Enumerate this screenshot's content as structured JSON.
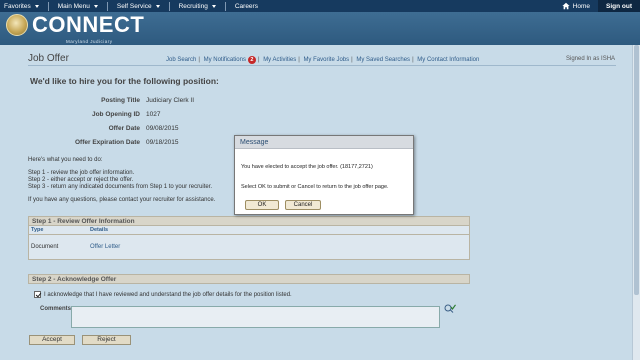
{
  "topnav": {
    "favorites": "Favorites",
    "main_menu": "Main Menu",
    "self_service": "Self Service",
    "recruiting": "Recruiting",
    "careers": "Careers",
    "home": "Home",
    "sign_out": "Sign out"
  },
  "branding": {
    "logo_text": "CONNECT",
    "logo_sub": "Maryland Judiciary"
  },
  "page": {
    "title": "Job Offer",
    "signed_in": "Signed In as ISHA",
    "links": {
      "job_search": "Job Search",
      "my_notifications": "My Notifications",
      "notifications_count": "2",
      "my_activities": "My Activities",
      "my_favorite_jobs": "My Favorite Jobs",
      "my_saved_searches": "My Saved Searches",
      "my_contact_information": "My Contact Information"
    },
    "heading": "We'd like to hire you for the following position:",
    "fields": {
      "posting_title_label": "Posting Title",
      "posting_title": "Judiciary Clerk II",
      "job_opening_id_label": "Job Opening ID",
      "job_opening_id": "1027",
      "offer_date_label": "Offer Date",
      "offer_date": "09/08/2015",
      "offer_expiration_label": "Offer Expiration Date",
      "offer_expiration": "09/18/2015"
    },
    "instructions": {
      "intro": "Here's what you need to do:",
      "step1": "Step 1 - review the job offer information.",
      "step2": "Step 2 - either accept or reject the offer.",
      "step3": "Step 3 - return any indicated documents from Step 1 to your recruiter.",
      "contact": "If you have any questions, please contact your recruiter for assistance."
    },
    "step1": {
      "header": "Step 1 - Review Offer Information",
      "col_type": "Type",
      "col_details": "Details",
      "row_type": "Document",
      "row_details": "Offer Letter"
    },
    "step2": {
      "header": "Step 2 - Acknowledge Offer",
      "ack_text": "I acknowledge that I have reviewed and understand the job offer details for the position listed.",
      "comments_label": "Comments"
    },
    "buttons": {
      "accept": "Accept",
      "reject": "Reject"
    }
  },
  "modal": {
    "title": "Message",
    "line1": "You have elected to accept the job offer. (18177,2721)",
    "line2": "Select OK to submit or Cancel to return to the job offer page.",
    "ok": "OK",
    "cancel": "Cancel"
  }
}
